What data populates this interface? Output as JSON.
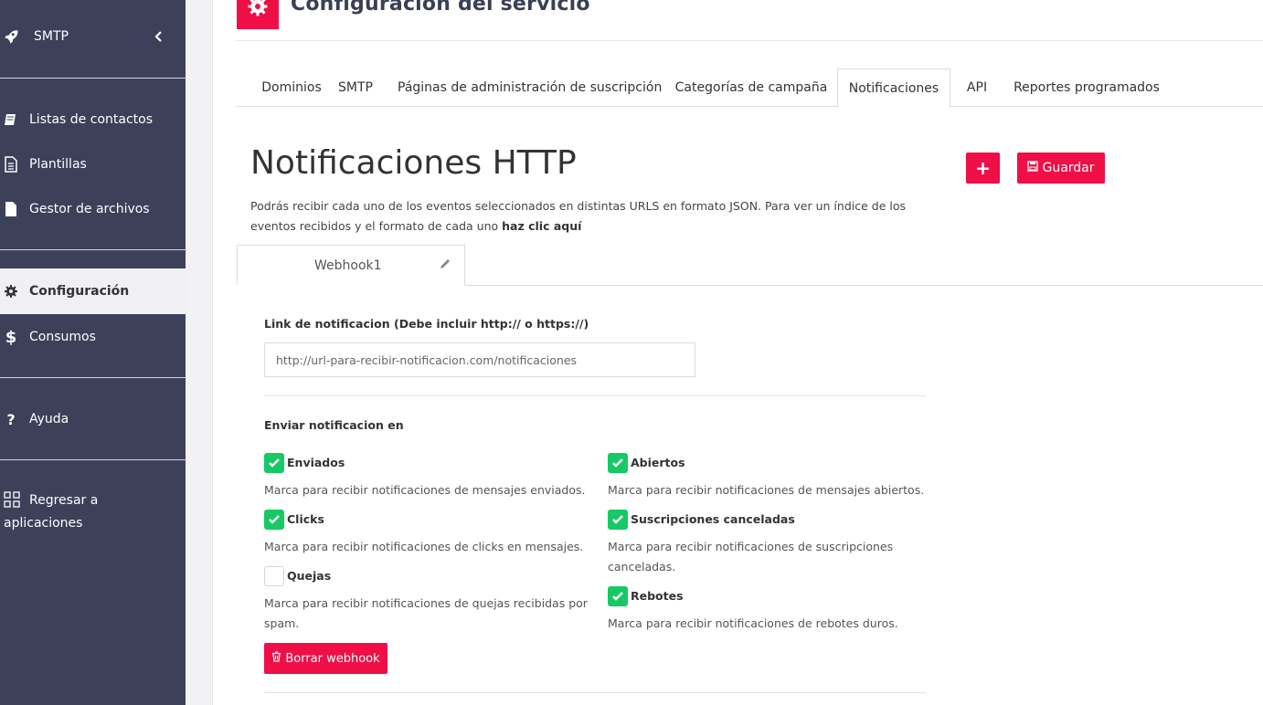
{
  "sidebar": {
    "smtp_label": "SMTP",
    "items": [
      {
        "label": "Listas de contactos",
        "icon": "book-icon"
      },
      {
        "label": "Plantillas",
        "icon": "document-icon"
      },
      {
        "label": "Gestor de archivos",
        "icon": "file-icon"
      },
      {
        "label": "Configuración",
        "icon": "gear-icon"
      },
      {
        "label": "Consumos",
        "icon": "dollar-icon"
      },
      {
        "label": "Ayuda",
        "icon": "question-icon"
      },
      {
        "label": "Regresar a aplicaciones",
        "icon": "grid-icon"
      }
    ]
  },
  "header": {
    "title": "Configuración del servicio"
  },
  "tabs": [
    {
      "label": "Dominios"
    },
    {
      "label": "SMTP"
    },
    {
      "label": "Páginas de administración de suscripción"
    },
    {
      "label": "Categorías de campaña"
    },
    {
      "label": "Notificaciones"
    },
    {
      "label": "API"
    },
    {
      "label": "Reportes programados"
    }
  ],
  "page": {
    "title": "Notificaciones HTTP",
    "description": "Podrás recibir cada uno de los eventos seleccionados en distintas URLS en formato JSON. Para ver un índice de los eventos recibidos y el formato de cada uno ",
    "description_link": "haz clic aquí",
    "plus_label": "+",
    "save_label": "Guardar"
  },
  "webhook": {
    "tab_label": "Webhook1",
    "link_label": "Link de notificacion (Debe incluir http:// o https://)",
    "link_placeholder": "http://url-para-recibir-notificacion.com/notificaciones",
    "send_label": "Enviar notificacion en",
    "events": [
      {
        "label": "Enviados",
        "desc": "Marca para recibir notificaciones de mensajes enviados.",
        "checked": true
      },
      {
        "label": "Abiertos",
        "desc": "Marca para recibir notificaciones de mensajes abiertos.",
        "checked": true
      },
      {
        "label": "Clicks",
        "desc": "Marca para recibir notificaciones de clicks en mensajes.",
        "checked": true
      },
      {
        "label": "Suscripciones canceladas",
        "desc1": "Marca para recibir notificaciones de suscripciones",
        "desc2": "canceladas.",
        "checked": true
      },
      {
        "label": "Quejas",
        "desc1": "Marca para recibir notificaciones de quejas recibidas por",
        "desc2": "spam.",
        "checked": false
      },
      {
        "label": "Rebotes",
        "desc": "Marca para recibir notificaciones de rebotes duros.",
        "checked": true
      }
    ],
    "delete_label": "Borrar webhook"
  },
  "colors": {
    "sidebar": "#3c4059",
    "accent": "#ef0f46",
    "check": "#17c964"
  }
}
